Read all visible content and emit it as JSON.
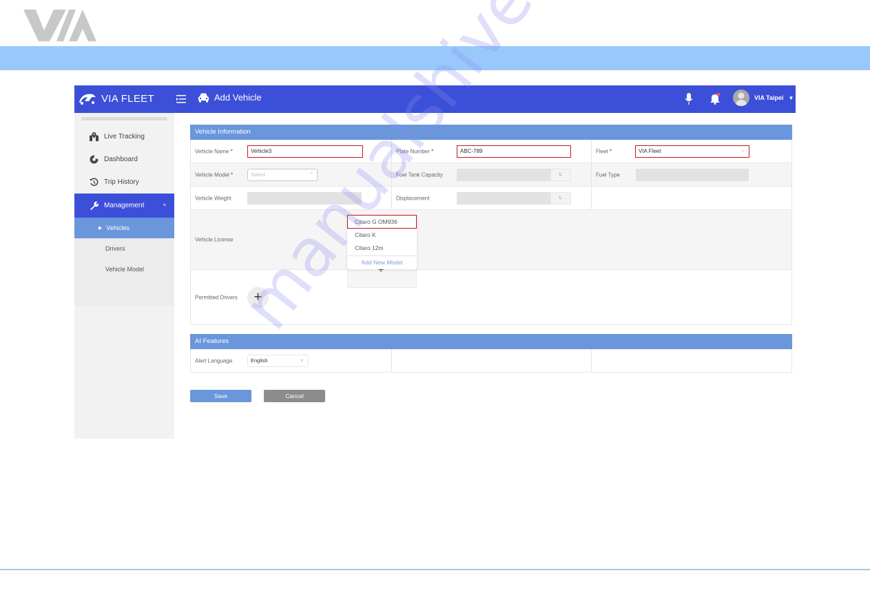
{
  "document": {
    "brand_logo": "VIA",
    "watermark": "manualshive.com",
    "colors": {
      "band": "#99c9fb",
      "footer_line": "#9ccbe8"
    }
  },
  "app": {
    "brand": "VIA FLEET",
    "page_title": "Add Vehicle",
    "user_name": "VIA Taipei",
    "colors": {
      "topbar": "#3c4fd8",
      "section_header": "#6a96dc",
      "highlight": "#c4161c",
      "cancel": "#8c8c8c"
    },
    "icons": {
      "menu": "menu-toggle-icon",
      "page": "car-icon",
      "mic": "microphone-icon",
      "bell": "bell-icon",
      "avatar": "user-avatar-icon"
    }
  },
  "sidebar": {
    "items": [
      {
        "label": "Live Tracking",
        "icon": "map-marker-icon"
      },
      {
        "label": "Dashboard",
        "icon": "pie-chart-icon"
      },
      {
        "label": "Trip History",
        "icon": "history-icon"
      },
      {
        "label": "Management",
        "icon": "wrench-icon",
        "expanded": true
      }
    ],
    "sub_items": [
      {
        "label": "Vehicles",
        "active": true
      },
      {
        "label": "Drivers"
      },
      {
        "label": "Vehicle Model"
      }
    ]
  },
  "vehicle_info": {
    "title": "Vehicle Information",
    "vehicle_name": {
      "label": "Vehicle Name",
      "value": "Vehicle3",
      "required": "*"
    },
    "plate_number": {
      "label": "Plate Number",
      "value": "ABC-789",
      "required": "*"
    },
    "fleet": {
      "label": "Fleet",
      "value": "VIA Fleet",
      "required": "*"
    },
    "vehicle_model": {
      "label": "Vehicle Model",
      "placeholder": "Select",
      "required": "*"
    },
    "fuel_tank_capacity": {
      "label": "Fuel Tank Capacity",
      "unit": "L"
    },
    "fuel_type": {
      "label": "Fuel Type"
    },
    "vehicle_weight": {
      "label": "Vehicle Weight"
    },
    "displacement": {
      "label": "Displacement",
      "unit": "L"
    },
    "vehicle_license": {
      "label": "Vehicle License"
    },
    "permitted_drivers": {
      "label": "Permitted Drivers"
    }
  },
  "model_dropdown": {
    "options": [
      "Citaro G OM936",
      "Citaro K",
      "Citaro 12m"
    ],
    "highlighted": "Citaro G OM936",
    "add_label": "Add New Model"
  },
  "ai_features": {
    "title": "AI Features",
    "alert_language": {
      "label": "Alert Language",
      "value": "English"
    }
  },
  "actions": {
    "save": "Save",
    "cancel": "Cancel"
  }
}
